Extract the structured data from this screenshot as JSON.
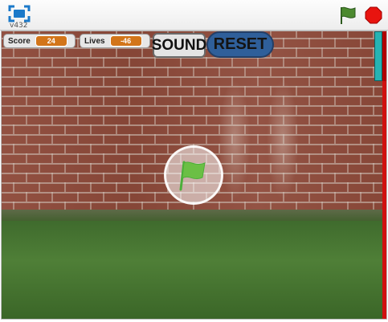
{
  "topbar": {
    "version": "v432",
    "icons": {
      "fullscreen": "fullscreen-icon",
      "green_flag": "green-flag-icon",
      "stop": "stop-sign-icon"
    }
  },
  "stage": {
    "monitors": {
      "score": {
        "label": "Score",
        "value": "24"
      },
      "lives": {
        "label": "Lives",
        "value": "-46"
      }
    },
    "buttons": {
      "sound": "SOUND",
      "reset": "RESET"
    },
    "play_overlay_icon": "green-flag-icon"
  },
  "colors": {
    "flag_green": "#4caf3a",
    "stop_red": "#e8140f",
    "monitor_orange": "#d2751a",
    "paddle_teal": "#26b3b3",
    "wall_red": "#d0100f"
  }
}
